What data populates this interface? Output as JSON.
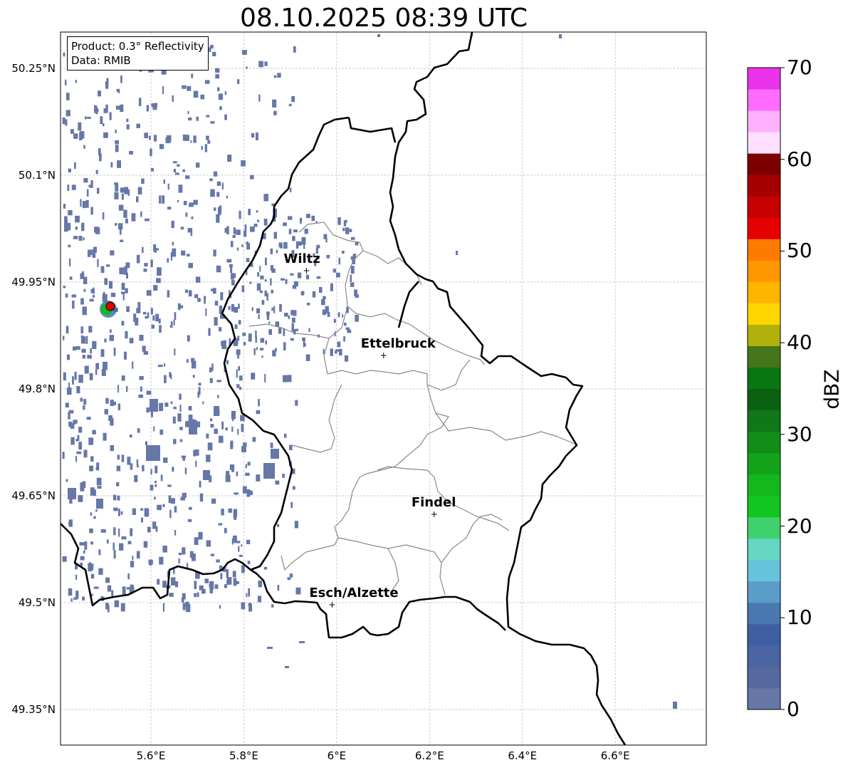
{
  "title": "08.10.2025 08:39 UTC",
  "info_box": {
    "product": "Product: 0.3° Reflectivity",
    "data": "Data: RMIB"
  },
  "lat_ticks": [
    "50.25°N",
    "50.1°N",
    "49.95°N",
    "49.8°N",
    "49.65°N",
    "49.5°N",
    "49.35°N"
  ],
  "lon_ticks": [
    "5.6°E",
    "5.8°E",
    "6°E",
    "6.2°E",
    "6.4°E",
    "6.6°E"
  ],
  "cities": [
    {
      "name": "Wiltz",
      "lon": 5.935,
      "lat": 49.966
    },
    {
      "name": "Ettelbruck",
      "lon": 6.101,
      "lat": 49.847
    },
    {
      "name": "Findel",
      "lon": 6.21,
      "lat": 49.624
    },
    {
      "name": "Esch/Alzette",
      "lon": 5.99,
      "lat": 49.497
    }
  ],
  "radar_site": {
    "lon": 5.505,
    "lat": 49.914
  },
  "colorbar": {
    "label": "dBZ",
    "ticks": [
      "0",
      "10",
      "20",
      "30",
      "40",
      "50",
      "60",
      "70"
    ],
    "min": 0,
    "max": 70,
    "step": 2.5,
    "colors": [
      "#6677a8",
      "#55699e",
      "#4b65a2",
      "#3f5ea4",
      "#4a78b1",
      "#5b9dc9",
      "#67c2db",
      "#64d6c1",
      "#3fd16d",
      "#13c61f",
      "#12b81c",
      "#12a31b",
      "#128d18",
      "#10771a",
      "#0a6112",
      "#087711",
      "#46761b",
      "#b0b10b",
      "#ffd500",
      "#ffb500",
      "#ff9800",
      "#ff7b00",
      "#e70000",
      "#c70000",
      "#a60000",
      "#7c0000",
      "#ffdfff",
      "#ffb1ff",
      "#ff6cff",
      "#ea33ea"
    ]
  }
}
